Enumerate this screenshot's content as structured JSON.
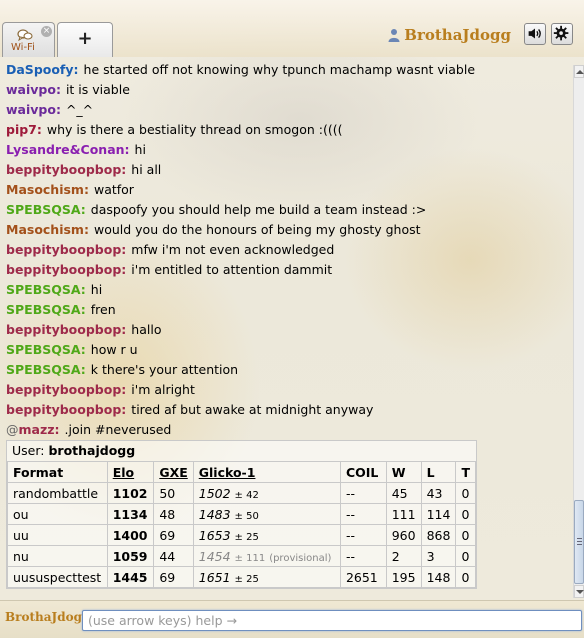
{
  "header": {
    "tab_label": "Wi-Fi",
    "close_glyph": "×",
    "add_glyph": "+",
    "username": "BrothaJdogg",
    "user_icon": "user-icon",
    "sound_icon": "sound-icon",
    "settings_icon": "gear-icon"
  },
  "chat": {
    "messages": [
      {
        "user": "DaSpoofy:",
        "text": "he started off not knowing why tpunch machamp wasnt viable",
        "color": "#1a5fb4"
      },
      {
        "user": "waivpo:",
        "text": "it is viable",
        "color": "#6b2a9a"
      },
      {
        "user": "waivpo:",
        "text": "^_^",
        "color": "#6b2a9a"
      },
      {
        "user": "pip7:",
        "text": "why is there a bestiality thread on smogon :((((",
        "color": "#9e1a3a"
      },
      {
        "user": "Lysandre&Conan:",
        "text": "hi",
        "color": "#8a1fb0"
      },
      {
        "user": "beppityboopbop:",
        "text": "hi all",
        "color": "#9e2a4a"
      },
      {
        "user": "Masochism:",
        "text": "watfor",
        "color": "#a3501a"
      },
      {
        "user": "SPEBSQSA:",
        "text": "daspoofy you should help me build a team instead :>",
        "color": "#4fa818"
      },
      {
        "user": "Masochism:",
        "text": "would you do the honours of being my ghosty ghost",
        "color": "#a3501a"
      },
      {
        "user": "beppityboopbop:",
        "text": "mfw i'm not even acknowledged",
        "color": "#9e2a4a"
      },
      {
        "user": "beppityboopbop:",
        "text": "i'm entitled to attention dammit",
        "color": "#9e2a4a"
      },
      {
        "user": "SPEBSQSA:",
        "text": "hi",
        "color": "#4fa818"
      },
      {
        "user": "SPEBSQSA:",
        "text": "fren",
        "color": "#4fa818"
      },
      {
        "user": "beppityboopbop:",
        "text": "hallo",
        "color": "#9e2a4a"
      },
      {
        "user": "SPEBSQSA:",
        "text": "how r u",
        "color": "#4fa818"
      },
      {
        "user": "SPEBSQSA:",
        "text": "k there's your attention",
        "color": "#4fa818"
      },
      {
        "user": "beppityboopbop:",
        "text": "i'm alright",
        "color": "#9e2a4a"
      },
      {
        "user": "beppityboopbop:",
        "text": "tired af but awake at midnight anyway",
        "color": "#9e2a4a"
      },
      {
        "user": "mazz:",
        "rank": "@",
        "text": ".join #neverused",
        "color": "#9e2a4a"
      }
    ]
  },
  "ranking": {
    "user_label": "User:",
    "user_value": "brothajdogg",
    "columns": [
      "Format",
      "Elo",
      "GXE",
      "Glicko-1",
      "COIL",
      "W",
      "L",
      "T"
    ],
    "rows": [
      {
        "format": "randombattle",
        "elo": "1102",
        "gxe": "50",
        "glicko": "1502",
        "dev": "± 42",
        "provisional": "",
        "coil": "--",
        "w": "45",
        "l": "43",
        "t": "0"
      },
      {
        "format": "ou",
        "elo": "1134",
        "gxe": "48",
        "glicko": "1483",
        "dev": "± 50",
        "provisional": "",
        "coil": "--",
        "w": "111",
        "l": "114",
        "t": "0"
      },
      {
        "format": "uu",
        "elo": "1400",
        "gxe": "69",
        "glicko": "1653",
        "dev": "± 25",
        "provisional": "",
        "coil": "--",
        "w": "960",
        "l": "868",
        "t": "0"
      },
      {
        "format": "nu",
        "elo": "1059",
        "gxe": "44",
        "glicko": "1454",
        "dev": "± 111",
        "provisional": "(provisional)",
        "coil": "--",
        "w": "2",
        "l": "3",
        "t": "0"
      },
      {
        "format": "uususpecttest",
        "elo": "1445",
        "gxe": "69",
        "glicko": "1651",
        "dev": "± 25",
        "provisional": "",
        "coil": "2651",
        "w": "195",
        "l": "148",
        "t": "0"
      }
    ]
  },
  "composer": {
    "name": "BrothaJdogg",
    "placeholder": "(use arrow keys) help →"
  }
}
